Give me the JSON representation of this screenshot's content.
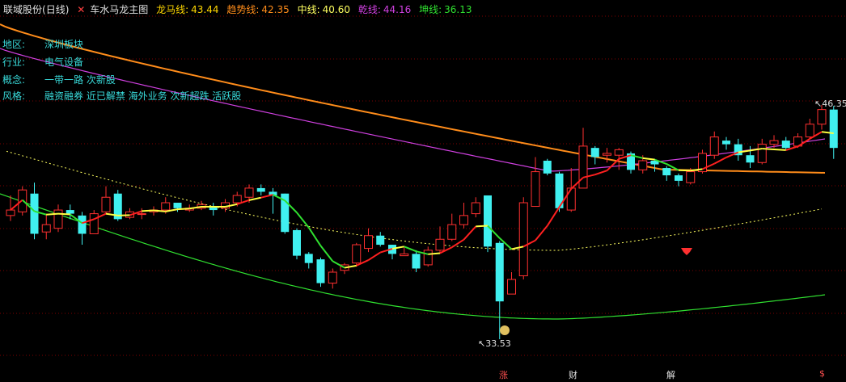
{
  "header": {
    "stock_name": "联域股份",
    "period": "(日线)",
    "indicator_name": "车水马龙主图",
    "indicators": [
      {
        "label": "龙马线:",
        "value": "43.44",
        "color": "#ffd700"
      },
      {
        "label": "趋势线:",
        "value": "42.35",
        "color": "#ff8c1a"
      },
      {
        "label": "中线:",
        "value": "40.60",
        "color": "#ffff60"
      },
      {
        "label": "乾线:",
        "value": "44.16",
        "color": "#d040e0"
      },
      {
        "label": "坤线:",
        "value": "36.13",
        "color": "#30e030"
      }
    ]
  },
  "info_panel": [
    {
      "key": "地区:",
      "value": "深圳板块"
    },
    {
      "key": "行业:",
      "value": "电气设备"
    },
    {
      "key": "概念:",
      "value": "一带一路 次新股"
    },
    {
      "key": "风格:",
      "value": "融资融券 近已解禁 海外业务 次新超跌 活跃股"
    }
  ],
  "price_labels": {
    "high": "46.35",
    "low": "33.53"
  },
  "bottom_markers": [
    "涨",
    "财",
    "解",
    "$"
  ],
  "colors": {
    "up": "#ff3030",
    "down": "#40f0f0",
    "background": "#000000",
    "grid": "#800000"
  },
  "chart_data": {
    "type": "candlestick",
    "high": 46.35,
    "low": 33.53,
    "candles": [
      [
        40.3,
        40.6,
        41.4,
        40.0
      ],
      [
        40.5,
        41.7,
        41.9,
        40.3
      ],
      [
        41.5,
        39.3,
        42.1,
        39.0
      ],
      [
        39.4,
        39.8,
        40.4,
        39.0
      ],
      [
        39.6,
        40.6,
        40.9,
        39.4
      ],
      [
        40.6,
        40.4,
        40.9,
        40.1
      ],
      [
        40.3,
        39.3,
        40.5,
        38.7
      ],
      [
        39.3,
        40.4,
        40.6,
        39.3
      ],
      [
        40.5,
        41.3,
        41.9,
        40.4
      ],
      [
        41.5,
        40.1,
        41.7,
        40.0
      ],
      [
        40.2,
        40.5,
        40.7,
        40.1
      ],
      [
        40.4,
        40.4,
        40.7,
        40.1
      ],
      [
        40.5,
        40.6,
        40.8,
        40.3
      ],
      [
        40.6,
        41.0,
        41.3,
        40.4
      ],
      [
        41.0,
        40.7,
        41.0,
        40.5
      ],
      [
        40.6,
        40.7,
        40.9,
        40.5
      ],
      [
        40.7,
        40.9,
        41.1,
        40.6
      ],
      [
        40.8,
        40.6,
        41.0,
        40.3
      ],
      [
        40.7,
        41.0,
        41.2,
        40.5
      ],
      [
        41.0,
        41.4,
        41.6,
        40.8
      ],
      [
        41.3,
        41.8,
        42.0,
        41.0
      ],
      [
        41.8,
        41.6,
        42.0,
        41.4
      ],
      [
        41.6,
        41.4,
        41.8,
        40.4
      ],
      [
        41.5,
        39.4,
        41.5,
        39.3
      ],
      [
        39.5,
        38.1,
        39.6,
        37.9
      ],
      [
        38.2,
        37.7,
        38.3,
        37.4
      ],
      [
        37.9,
        36.6,
        38.0,
        36.4
      ],
      [
        36.6,
        37.2,
        37.4,
        36.3
      ],
      [
        37.3,
        37.6,
        37.7,
        37.1
      ],
      [
        37.7,
        38.7,
        38.8,
        37.5
      ],
      [
        38.5,
        39.2,
        39.6,
        38.3
      ],
      [
        39.2,
        38.7,
        39.4,
        38.6
      ],
      [
        38.7,
        38.2,
        38.7,
        37.9
      ],
      [
        38.1,
        38.2,
        38.6,
        38.1
      ],
      [
        38.2,
        37.4,
        38.4,
        37.2
      ],
      [
        37.6,
        38.4,
        38.6,
        37.5
      ],
      [
        38.4,
        39.0,
        39.7,
        38.2
      ],
      [
        39.0,
        39.8,
        40.4,
        38.9
      ],
      [
        39.8,
        40.3,
        41.0,
        39.6
      ],
      [
        40.4,
        41.0,
        41.3,
        40.2
      ],
      [
        41.4,
        38.6,
        41.4,
        38.3
      ],
      [
        38.8,
        35.6,
        38.9,
        33.53
      ],
      [
        36.0,
        36.8,
        37.2,
        36.0
      ],
      [
        37.0,
        41.0,
        41.3,
        36.8
      ],
      [
        40.8,
        42.7,
        43.5,
        40.8
      ],
      [
        43.3,
        42.6,
        43.4,
        42.5
      ],
      [
        42.6,
        40.7,
        42.7,
        40.5
      ],
      [
        40.6,
        41.8,
        42.9,
        40.5
      ],
      [
        41.8,
        44.1,
        45.1,
        41.8
      ],
      [
        44.0,
        43.5,
        44.1,
        43.1
      ],
      [
        43.6,
        43.7,
        44.0,
        43.2
      ],
      [
        43.6,
        43.9,
        44.0,
        42.8
      ],
      [
        43.7,
        42.8,
        43.8,
        42.6
      ],
      [
        42.8,
        43.3,
        43.6,
        42.6
      ],
      [
        43.3,
        43.1,
        43.4,
        42.7
      ],
      [
        42.9,
        42.5,
        43.0,
        42.2
      ],
      [
        42.5,
        42.2,
        42.6,
        41.9
      ],
      [
        42.1,
        42.7,
        42.9,
        42.0
      ],
      [
        42.7,
        43.7,
        43.9,
        42.6
      ],
      [
        43.6,
        44.6,
        44.9,
        43.4
      ],
      [
        44.4,
        44.2,
        44.6,
        43.9
      ],
      [
        44.2,
        43.6,
        44.5,
        43.3
      ],
      [
        43.6,
        43.2,
        44.1,
        42.9
      ],
      [
        43.2,
        44.2,
        44.5,
        43.1
      ],
      [
        44.2,
        44.4,
        44.7,
        44.0
      ],
      [
        44.4,
        44.0,
        44.6,
        43.9
      ],
      [
        44.1,
        44.6,
        44.8,
        44.0
      ],
      [
        44.6,
        45.3,
        45.6,
        44.5
      ],
      [
        45.3,
        46.1,
        46.35,
        45.0
      ],
      [
        46.1,
        44.0,
        46.3,
        43.4
      ]
    ]
  }
}
